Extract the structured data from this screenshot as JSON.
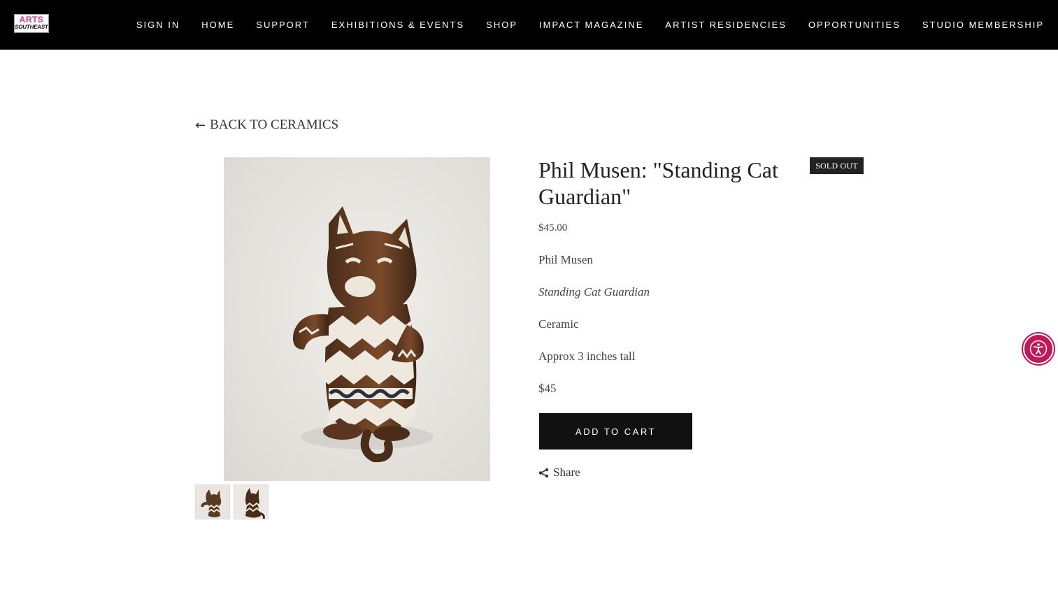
{
  "header": {
    "logo": {
      "line1": "ARTS",
      "line2": "SOUTHEAST"
    },
    "nav": [
      "SIGN IN",
      "HOME",
      "SUPPORT",
      "EXHIBITIONS & EVENTS",
      "SHOP",
      "IMPACT MAGAZINE",
      "ARTIST RESIDENCIES",
      "OPPORTUNITIES",
      "STUDIO MEMBERSHIP"
    ]
  },
  "back_link": {
    "icon": "arrow-left-icon",
    "label": "BACK TO CERAMICS"
  },
  "product": {
    "title": "Phil Musen: \"Standing Cat Guardian\"",
    "badge": "SOLD OUT",
    "price": "$45.00",
    "description": {
      "artist": "Phil Musen",
      "work_title": "Standing Cat Guardian",
      "medium": "Ceramic",
      "size": "Approx 3 inches tall",
      "price": "$45"
    },
    "add_to_cart_label": "ADD TO CART",
    "share_label": "Share",
    "share_icon": "share-icon"
  },
  "accessibility_widget": {
    "icon": "accessibility-icon"
  },
  "colors": {
    "header_bg": "#000000",
    "button_bg": "#111111",
    "badge_bg": "#222222",
    "accessibility": "#c2185b"
  }
}
